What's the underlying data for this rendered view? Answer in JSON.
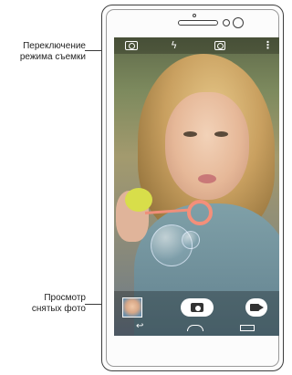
{
  "callouts": {
    "mode_switch": {
      "line1": "Переключение",
      "line2": "режима съемки"
    },
    "gallery": {
      "line1": "Просмотр",
      "line2": "снятых фото"
    }
  },
  "icons": {
    "top_bar": [
      "mode-switch-icon",
      "flash-off-icon",
      "switch-camera-icon",
      "menu-icon"
    ],
    "bottom_bar": [
      "gallery-thumbnail",
      "shutter-button",
      "video-button"
    ],
    "navigation": [
      "back-icon",
      "home-icon",
      "recent-apps-icon"
    ]
  },
  "glyphs": {
    "flash_off": "ϟ",
    "menu": "⋮",
    "back": "↩"
  },
  "colors": {
    "device_outline": "#3d3d3d",
    "ui_white": "#ffffff",
    "bubble_wand": "#f48f7a",
    "wand_cap": "#d8de4a"
  }
}
